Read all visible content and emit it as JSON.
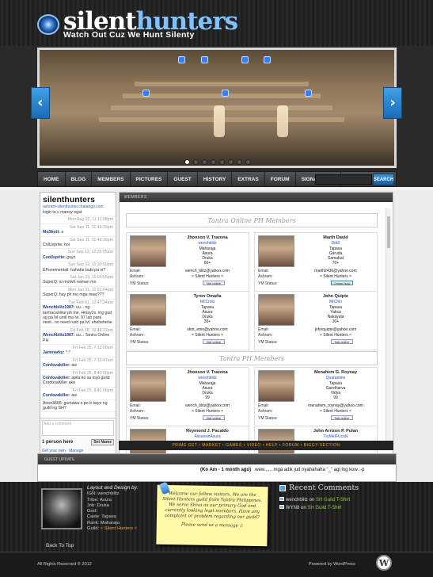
{
  "site": {
    "brand_a": "silent",
    "brand_b": "hunters",
    "tagline": "Watch Out Cuz We Hunt Silenty"
  },
  "nav": [
    "HOME",
    "BLOG",
    "MEMBERS",
    "PICTURES",
    "GUEST",
    "HISTORY",
    "EXTRAS",
    "FORUM",
    "SIGNATURES"
  ],
  "search": {
    "button": "SEARCH",
    "placeholder": ""
  },
  "chat": {
    "title": "silenthunters",
    "link": "ashram-silenthunter.chatango.com",
    "messages": [
      {
        "text": "login to c manoy egat",
        "time": ""
      },
      {
        "text": "",
        "time": "Mon Aug 22, 11:11:08pm"
      },
      {
        "user": "MeSkott:",
        "text": "a",
        "time": "Sat Sep 11, 11:46:30pm"
      },
      {
        "text": "ColUsprite: hoi",
        "time": "Sat Sep 11, 11:46:16pm"
      },
      {
        "user": "Coollsprite:",
        "text": "guyz",
        "time": "Sun Sep 12, 12:35:05am"
      },
      {
        "text": "EPunementall: hahaha bubi pa ni?",
        "time": "Sun Sep 12, 11:30:50pm"
      },
      {
        "text": "SuperQ: ai motwh naman mo",
        "time": "Sat Jan 23, 11:05:55pm"
      },
      {
        "text": "SuperQ: hay ph mo mga maw???",
        "time": "Mon Jan 31, 11:01:04pm"
      },
      {
        "user": "Wenchblitz1987:",
        "text": "uu... ng tantracanline ph me. Hinay2x. lng gud ug pa lvl until ma lvl. 97 lah para vesti.. no need rush pa lvl. ehehehehe",
        "time": "Tue Feb 01, 12:47:34am"
      },
      {
        "user": "Wenchblitz1987:",
        "text": "uu... Tantra Online PH",
        "time": "Fri Feb 18, 10:46:22pm"
      },
      {
        "user": "Jammarky:",
        "text": "^.^",
        "time": "Fri Feb 25, 7:13:00am"
      },
      {
        "user": "Cordovakiller:",
        "text": "aw",
        "time": "Fri Feb 25, 7:13:47am"
      },
      {
        "user": "Cordovakiller:",
        "text": "apila ko sa inyo guild CordovaKiller ako",
        "time": "Fri Feb 25, 8:40:00pm"
      },
      {
        "user": "Cordovakiller:",
        "text": "aw",
        "time": "Fri Feb 25, 8:41:06pm"
      },
      {
        "text": "Anon3666: gumawa n po b kayo ng guild ng SH?",
        "time": ""
      }
    ],
    "input_placeholder": "Add a comment",
    "online": "1 person here",
    "set_name": "Set Name",
    "get_own": "Get your own",
    "manage": "Manage"
  },
  "main": {
    "header": "MEMBERS",
    "sections": [
      "Tantra Online PH Members",
      "Tantra PH Members"
    ],
    "labels": {
      "email": "Email:",
      "ashram": "Ashram:",
      "ym": "YM Status:"
    },
    "members": [
      {
        "name": "Jhonson V. Trazona",
        "screen": "wenchblitz",
        "r1": "Maharaja",
        "r2": "Asura",
        "r3": "Druka",
        "r4": "60+",
        "email": "wench_blitz@yahoo.com",
        "ashram": "× Silent Hunters ×",
        "status": "Not online"
      },
      {
        "name": "Marth David",
        "screen": "Dirt0",
        "r1": "Tapasa",
        "r2": "Garuda",
        "r3": "Samabat",
        "r4": "70+",
        "email": "marth2430@yahoo.com",
        "ashram": "× Silent Hunters ×",
        "status": "Online Now"
      },
      {
        "name": "Tyron Omaña",
        "screen": "McCrois",
        "r1": "Tapasa",
        "r2": "Asura",
        "r3": "Druka",
        "r4": "30+",
        "email": "skot_emo@yahoo.com",
        "ashram": "× Silent Hunters ×",
        "status": "Not online"
      },
      {
        "name": "John Quipte",
        "screen": "MrChin",
        "r1": "Tapasa",
        "r2": "Yakca",
        "r3": "Nakayula",
        "r4": "30+",
        "email": "johnquipte@yahoo.com",
        "ashram": "× Silent Hunters ×",
        "status": "Not online"
      },
      {
        "name": "Jhonson V. Trazona",
        "screen": "wenchblitz",
        "r1": "Maharaja",
        "r2": "Asura",
        "r3": "Druka",
        "r4": "99",
        "email": "wench_blitz@yahoo.com",
        "ashram": "× Silent Hunters ×",
        "status": "Not online"
      },
      {
        "name": "Menahem G. Roynay",
        "screen": "Quarantine",
        "r1": "Tapasa",
        "r2": "Gandharva",
        "r3": "Vidya",
        "r4": "99",
        "email": "menahem_roynay@yahoo.com",
        "ashram": "× Silent Hunters ×",
        "status": "Not online"
      },
      {
        "name": "Reymond J. Pacaldo",
        "screen": "AssassinAsura",
        "r1": "",
        "r2": "",
        "r3": "",
        "r4": "",
        "email": "",
        "ashram": "",
        "status": ""
      },
      {
        "name": "John Arrizon P. Pulan",
        "screen": "TryMeIFUcaN",
        "r1": "",
        "r2": "",
        "r3": "",
        "r4": "",
        "email": "",
        "ashram": "",
        "status": ""
      }
    ],
    "footer_links": "PRIME GET • MARKET • GAMES • VIDEO • HELP • FORUM • BIGGY SECTION"
  },
  "guest": {
    "header": "GUEST UPDATE",
    "message_a": "(Ko Am - 1 month ago)",
    "message_b": "wew.,.,., mga adik jud nyahahaha \"_\" agi lng kow :-p"
  },
  "credits": {
    "head": "Layout and Design by:",
    "lines": [
      "IGN: wenchblitz",
      "Tribe: Asura",
      "Job: Druka",
      "God: ",
      "Caste: Tapasa",
      "Rank: Maharaja",
      "Guild: "
    ],
    "guild": "× Silent Hunters ×"
  },
  "note": {
    "text": "Welcome our fellow visitors. We are the Silent Hunters guild from Tantra Philippines. We serve Shiva as our primary God and currently looking legit members. Have any complaint or problem regarding our guild?",
    "tail": "Please send us a message :)"
  },
  "recent": {
    "title": "Recent Comments",
    "items": [
      {
        "who": "wenchblitz on ",
        "what": "SH Guild T-Shirt"
      },
      {
        "who": "WYN8 on ",
        "what": "SH Guild T-Shirt"
      }
    ]
  },
  "back_to_top": "Back To Top",
  "copyright": "All Rights Reserved ® 2012",
  "powered": "Powered by WordPress"
}
